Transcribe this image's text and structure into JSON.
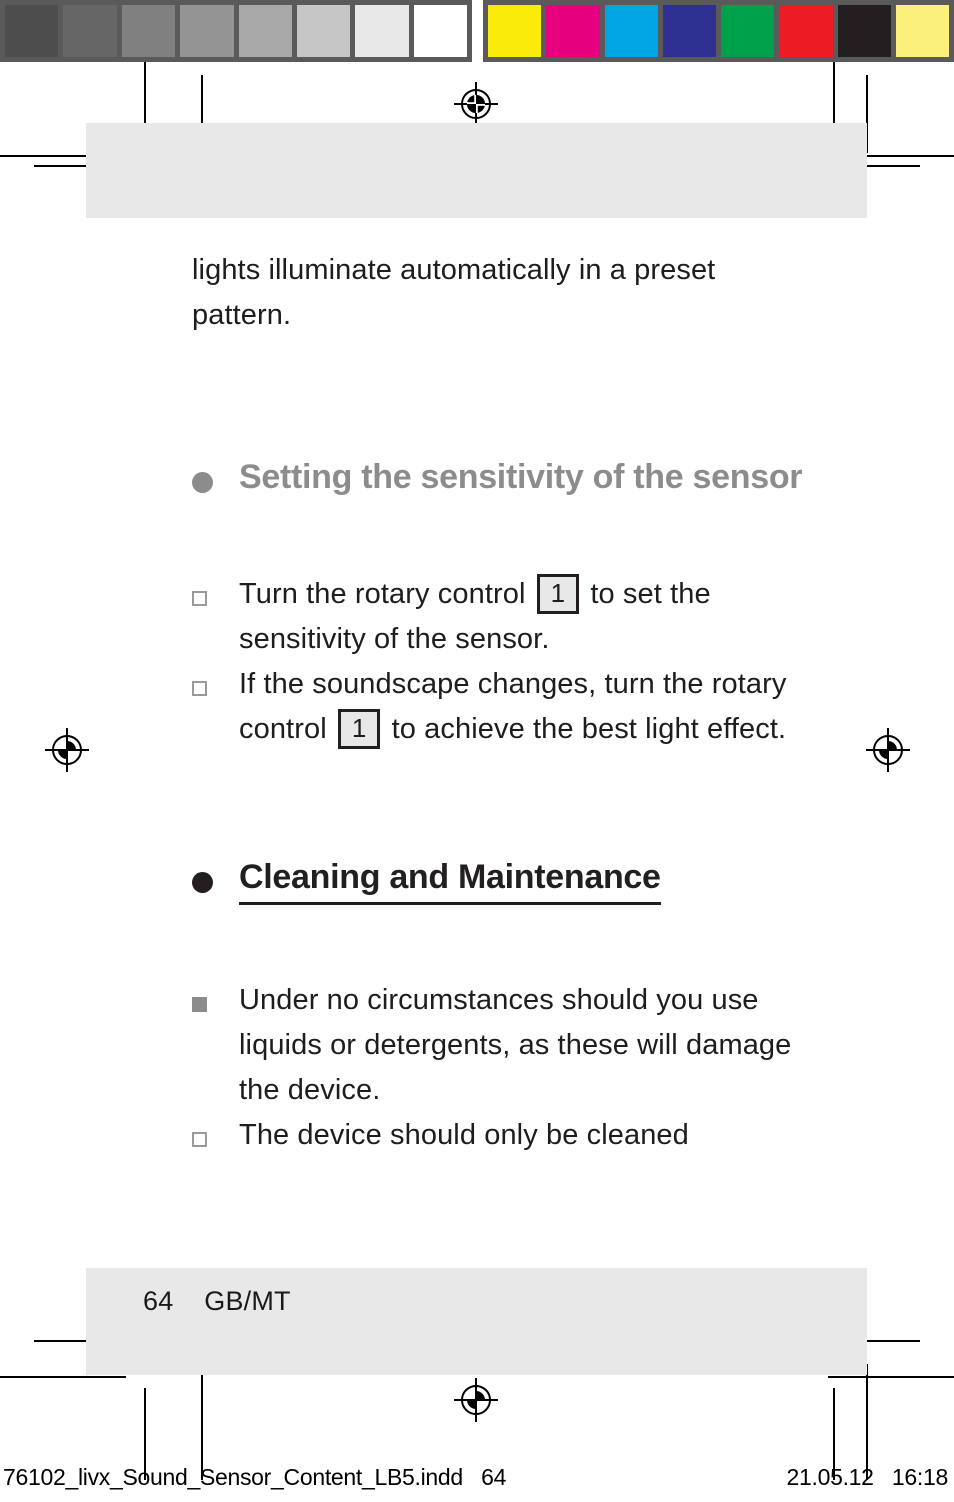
{
  "calibration": {
    "gray_swatches": [
      "#4d4d4d",
      "#666666",
      "#808080",
      "#949494",
      "#a8a8a8",
      "#c6c6c6",
      "#e8e8e8",
      "#ffffff"
    ],
    "color_swatches": [
      "#faea0a",
      "#e6007e",
      "#00a5e3",
      "#2e3192",
      "#00a14b",
      "#ed1c24",
      "#231f20",
      "#fbf07c"
    ],
    "strip_background": "#5a5a5a"
  },
  "page": {
    "band_color": "#e8e8e8",
    "footer": {
      "page_number": "64",
      "language_code": "GB/MT",
      "text": "64    GB/MT"
    }
  },
  "content": {
    "intro_paragraph": "lights illuminate automatically in a preset pattern.",
    "sections": [
      {
        "bullet_style": "dot-gray",
        "heading": "Setting the sensitivity of the sensor",
        "heading_color": "#8c8c8c",
        "underlined": false,
        "items": [
          {
            "bullet_style": "square-hollow",
            "parts": [
              {
                "type": "text",
                "value": "Turn the rotary control "
              },
              {
                "type": "ref",
                "value": "1"
              },
              {
                "type": "text",
                "value": " to set the sensitivity of the sensor."
              }
            ]
          },
          {
            "bullet_style": "square-hollow",
            "parts": [
              {
                "type": "text",
                "value": "If the soundscape changes, turn the rotary control "
              },
              {
                "type": "ref",
                "value": "1"
              },
              {
                "type": "text",
                "value": " to achieve the best light effect."
              }
            ]
          }
        ]
      },
      {
        "bullet_style": "dot-black",
        "heading": "Cleaning and Maintenance",
        "heading_color": "#231f20",
        "underlined": true,
        "items": [
          {
            "bullet_style": "square-filled",
            "parts": [
              {
                "type": "text",
                "value": "Under no circumstances should you use liquids or detergents, as these will damage the device."
              }
            ]
          },
          {
            "bullet_style": "square-hollow",
            "parts": [
              {
                "type": "text",
                "value": "The device should only be cleaned"
              }
            ]
          }
        ]
      }
    ]
  },
  "slug": {
    "filename": "76102_livx_Sound_Sensor_Content_LB5.indd",
    "page": "64",
    "left_text": "76102_livx_Sound_Sensor_Content_LB5.indd   64",
    "date": "21.05.12",
    "time": "16:18",
    "right_text": "21.05.12   16:18"
  }
}
